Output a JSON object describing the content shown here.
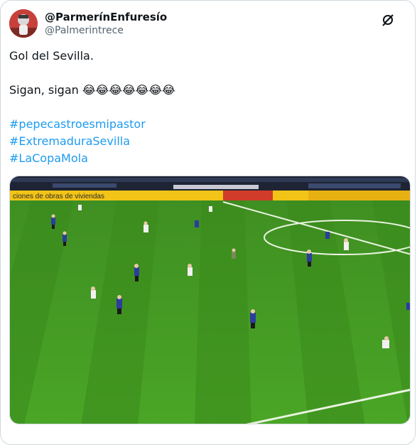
{
  "user": {
    "display_name": "@ParmerínEnfuresío",
    "handle": "@Palmerintrece",
    "avatar_icon": "profile-avatar"
  },
  "brand_icon": "x-logo-icon",
  "tweet": {
    "line1": "Gol del Sevilla.",
    "line2": "Sigan, sigan",
    "emoji": "😂😂😂😂😂😂😂",
    "hashtags": [
      "#pepecastroesmipastor",
      "#ExtremaduraSevilla",
      "#LaCopaMola"
    ]
  },
  "media": {
    "kind": "soccer-match-video-frame",
    "banner_text": "ciones de obras de viviendas"
  },
  "colors": {
    "link": "#1d9bf0",
    "text": "#0f1419",
    "secondary": "#536471",
    "border": "#cfd9de",
    "pitch": "#3f9a1f"
  }
}
